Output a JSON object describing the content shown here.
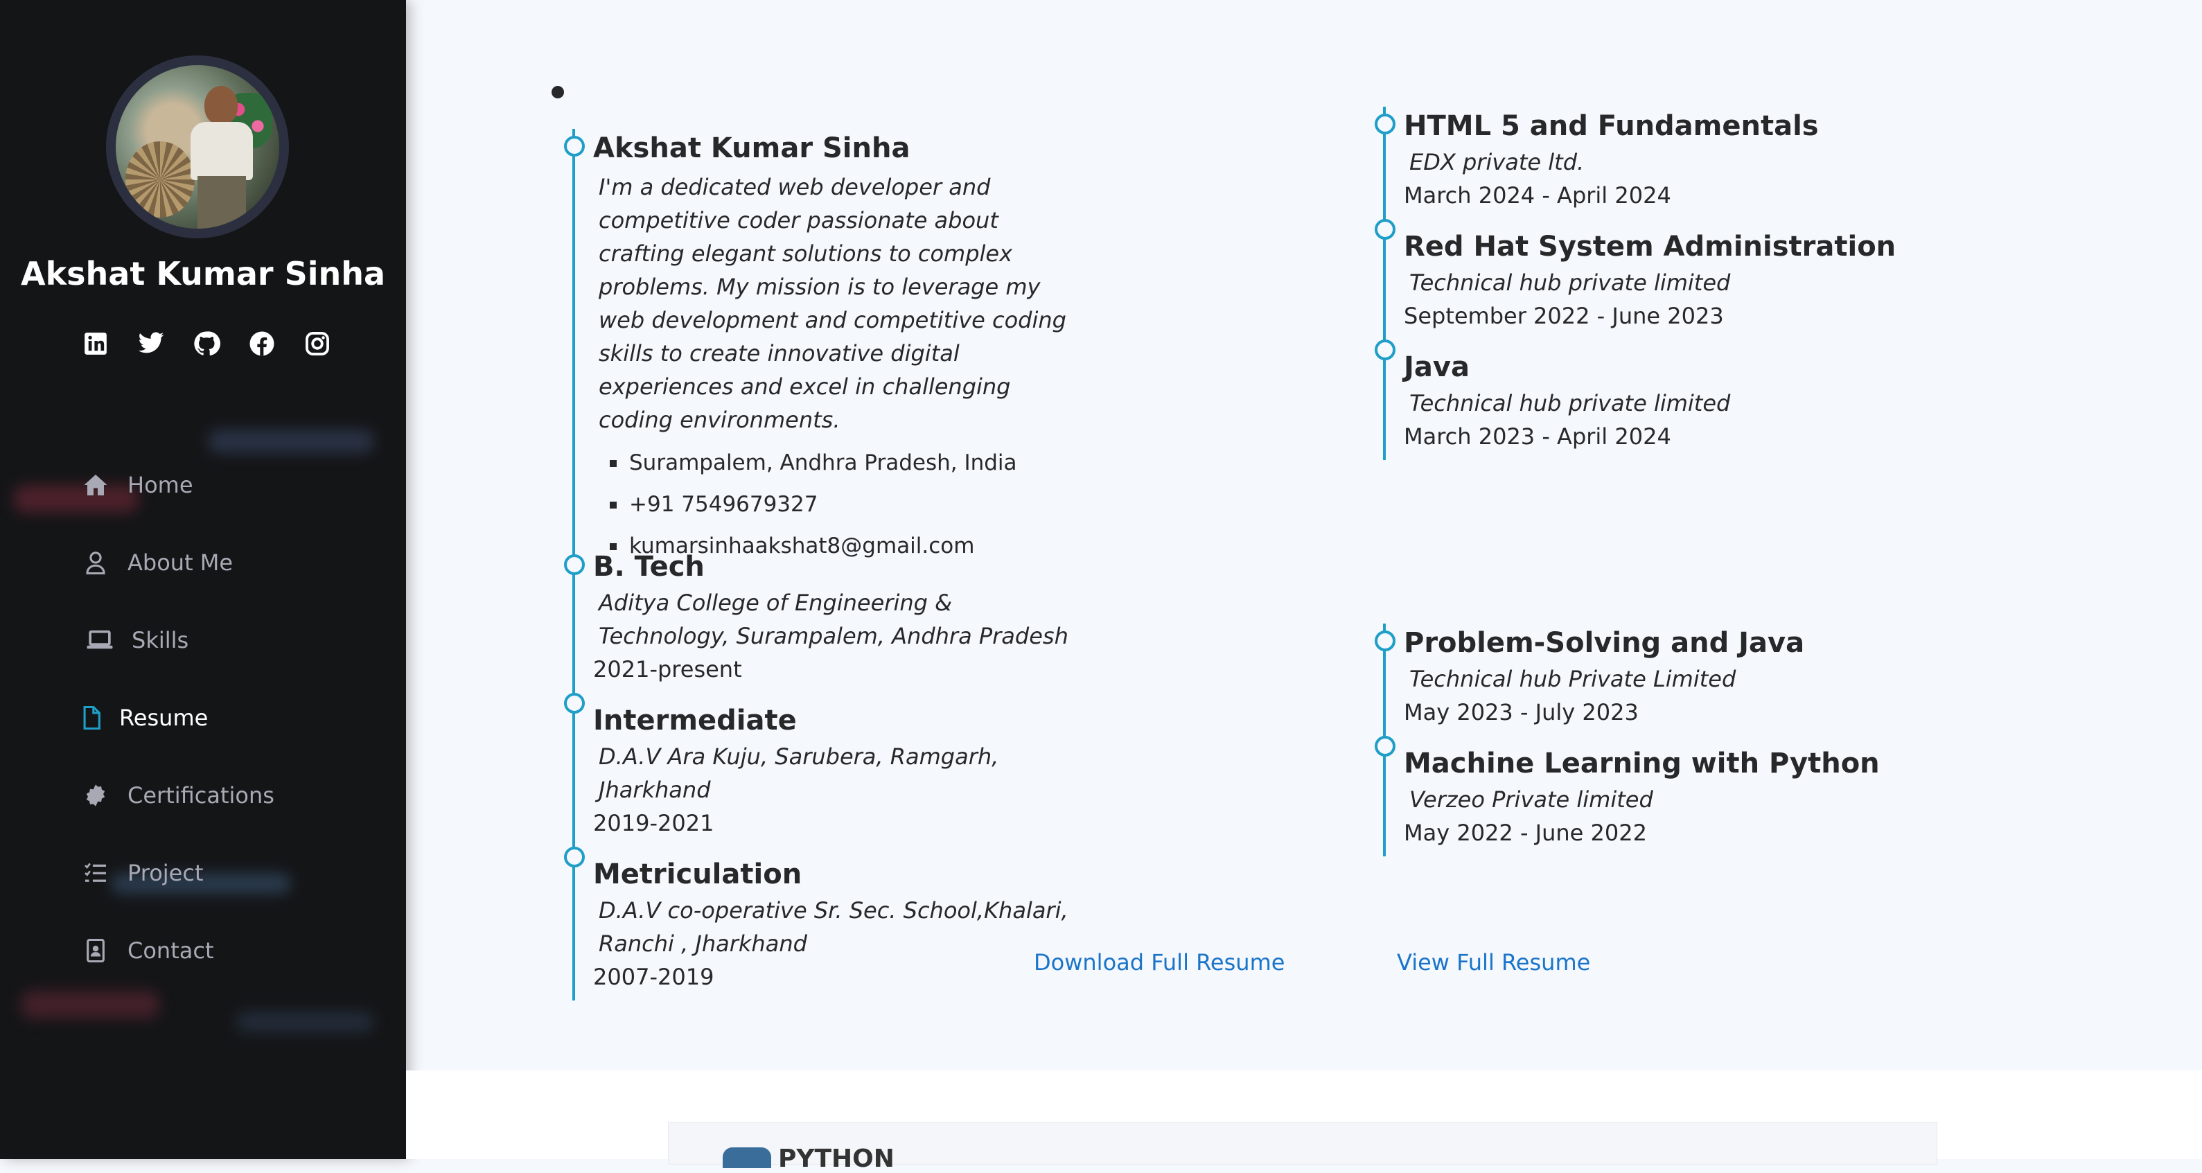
{
  "colors": {
    "accent": "#1f9ec8",
    "link": "#1a74c9",
    "sidebar_bg": "#141517",
    "main_bg": "#f5f8fc"
  },
  "profile": {
    "name": "Akshat Kumar Sinha"
  },
  "social": [
    "linkedin-icon",
    "twitter-icon",
    "github-icon",
    "facebook-icon",
    "instagram-icon"
  ],
  "nav": [
    {
      "label": "Home",
      "icon": "home-icon"
    },
    {
      "label": "About Me",
      "icon": "user-icon"
    },
    {
      "label": "Skills",
      "icon": "laptop-icon"
    },
    {
      "label": "Resume",
      "icon": "file-icon",
      "active": true
    },
    {
      "label": "Certifications",
      "icon": "badge-icon"
    },
    {
      "label": "Project",
      "icon": "list-icon"
    },
    {
      "label": "Contact",
      "icon": "contact-card-icon"
    }
  ],
  "summary": {
    "name": "Akshat Kumar Sinha",
    "description": "I'm a dedicated web developer and competitive coder passionate about crafting elegant solutions to complex problems. My mission is to leverage my web development and competitive coding skills to create innovative digital experiences and excel in challenging coding environments.",
    "contacts": [
      "Surampalem, Andhra Pradesh, India",
      "+91 7549679327",
      "kumarsinhaakshat8@gmail.com"
    ]
  },
  "education": [
    {
      "title": "B. Tech",
      "org": "Aditya College of Engineering & Technology, Surampalem, Andhra Pradesh",
      "period": "2021-present"
    },
    {
      "title": "Intermediate",
      "org": "D.A.V Ara Kuju, Sarubera, Ramgarh, Jharkhand",
      "period": "2019-2021"
    },
    {
      "title": "Metriculation",
      "org": "D.A.V co-operative Sr. Sec. School,Khalari, Ranchi , Jharkhand",
      "period": "2007-2019"
    }
  ],
  "certifications_top": [
    {
      "title": "HTML 5 and Fundamentals",
      "org": "EDX private ltd.",
      "period": "March 2024 - April 2024"
    },
    {
      "title": "Red Hat System Administration",
      "org": "Technical hub private limited",
      "period": "September 2022 - June 2023"
    },
    {
      "title": "Java",
      "org": "Technical hub private limited",
      "period": "March 2023 - April 2024"
    }
  ],
  "certifications_bottom": [
    {
      "title": "Problem-Solving and Java",
      "org": "Technical hub Private Limited",
      "period": "May 2023 - July 2023"
    },
    {
      "title": "Machine Learning with Python",
      "org": "Verzeo Private limited",
      "period": "May 2022 - June 2022"
    }
  ],
  "links": {
    "download": "Download Full Resume",
    "view": "View Full Resume"
  },
  "next_section": {
    "logo_text": "PYTHON"
  }
}
